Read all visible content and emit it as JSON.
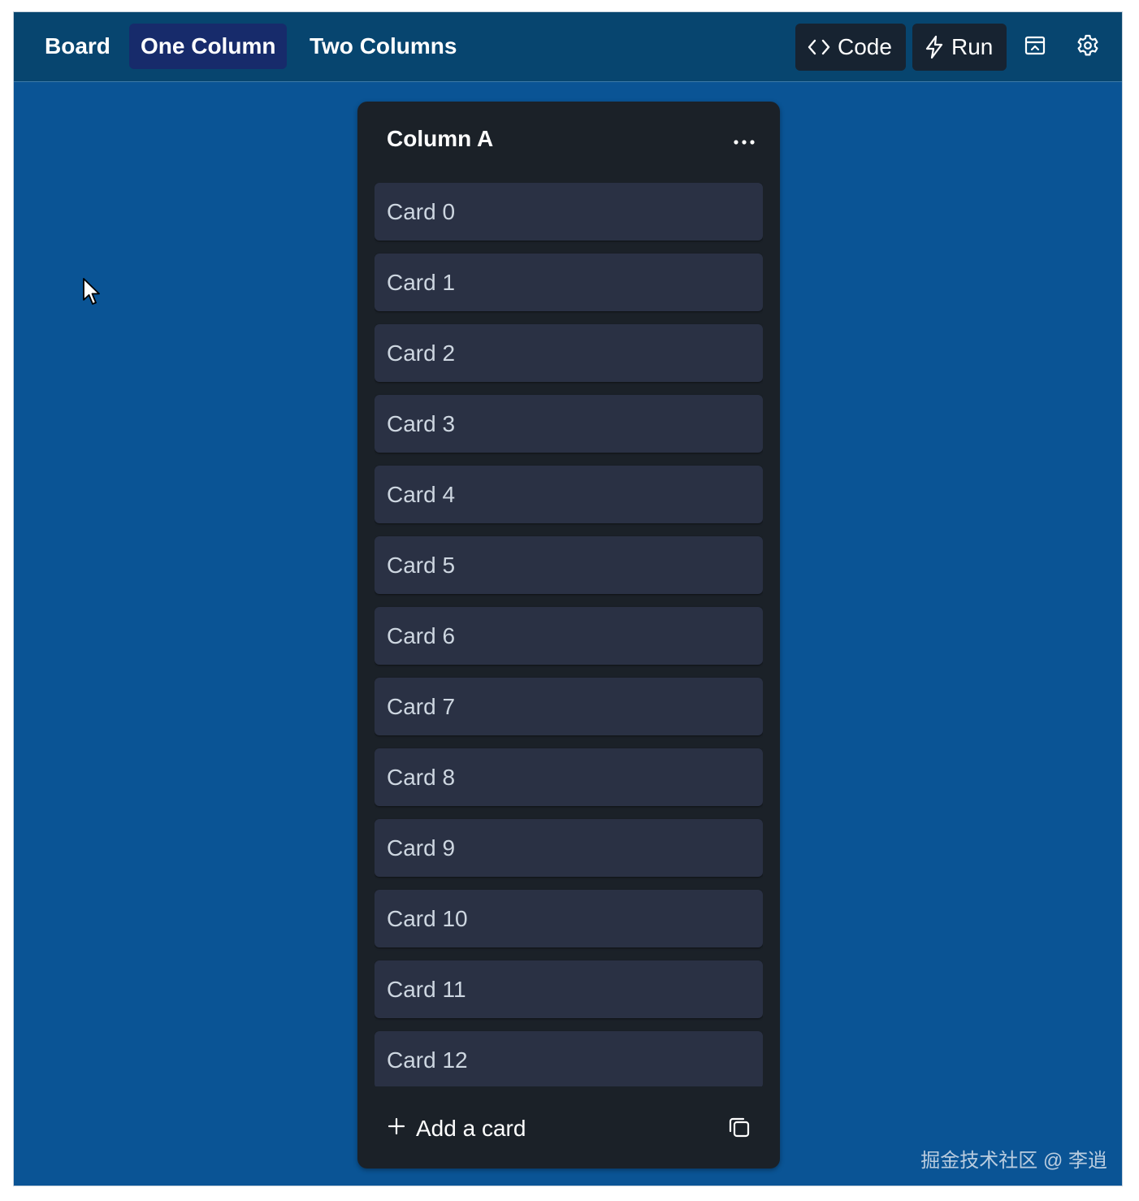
{
  "nav": {
    "tabs": [
      {
        "label": "Board"
      },
      {
        "label": "One Column"
      },
      {
        "label": "Two Columns"
      }
    ],
    "active_tab": "One Column"
  },
  "toolbar": {
    "code_label": "Code",
    "run_label": "Run",
    "icons": [
      "code-icon",
      "lightning-icon",
      "panel-icon",
      "gear-icon"
    ]
  },
  "column": {
    "title": "Column A",
    "cards": [
      {
        "label": "Card 0"
      },
      {
        "label": "Card 1"
      },
      {
        "label": "Card 2"
      },
      {
        "label": "Card 3"
      },
      {
        "label": "Card 4"
      },
      {
        "label": "Card 5"
      },
      {
        "label": "Card 6"
      },
      {
        "label": "Card 7"
      },
      {
        "label": "Card 8"
      },
      {
        "label": "Card 9"
      },
      {
        "label": "Card 10"
      },
      {
        "label": "Card 11"
      },
      {
        "label": "Card 12"
      }
    ],
    "add_card_label": "Add a card"
  },
  "watermark": "掘金技术社区 @ 李逍",
  "colors": {
    "background": "#0a5495",
    "topbar": "#07456f",
    "active_tab": "#172b6b",
    "column": "#1b2128",
    "card": "#2a3144",
    "card_text": "#cdd6e0"
  }
}
